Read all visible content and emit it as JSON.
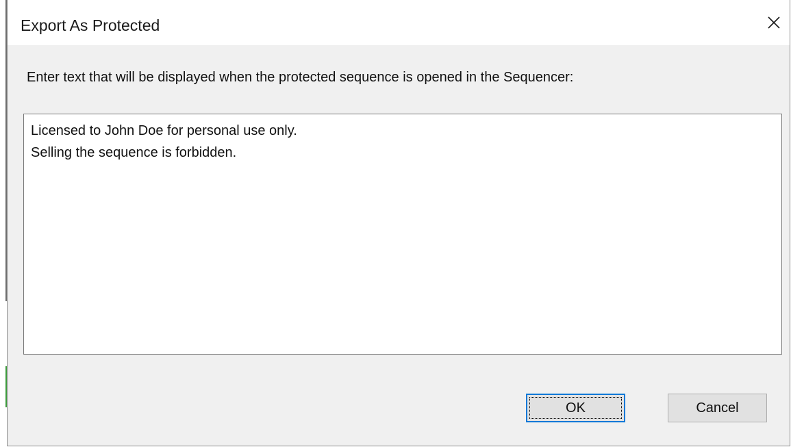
{
  "dialog": {
    "title": "Export As Protected",
    "prompt": "Enter text that will be displayed when the protected sequence is opened in the Sequencer:",
    "message_lines": [
      "Licensed to John Doe for personal use only.",
      "Selling the sequence is forbidden."
    ],
    "buttons": {
      "ok_label": "OK",
      "cancel_label": "Cancel"
    },
    "close_icon": "close-icon"
  },
  "colors": {
    "dialog_background": "#f0f0f0",
    "titlebar_background": "#ffffff",
    "focus_border": "#0078d7",
    "button_background": "#e1e1e1"
  }
}
